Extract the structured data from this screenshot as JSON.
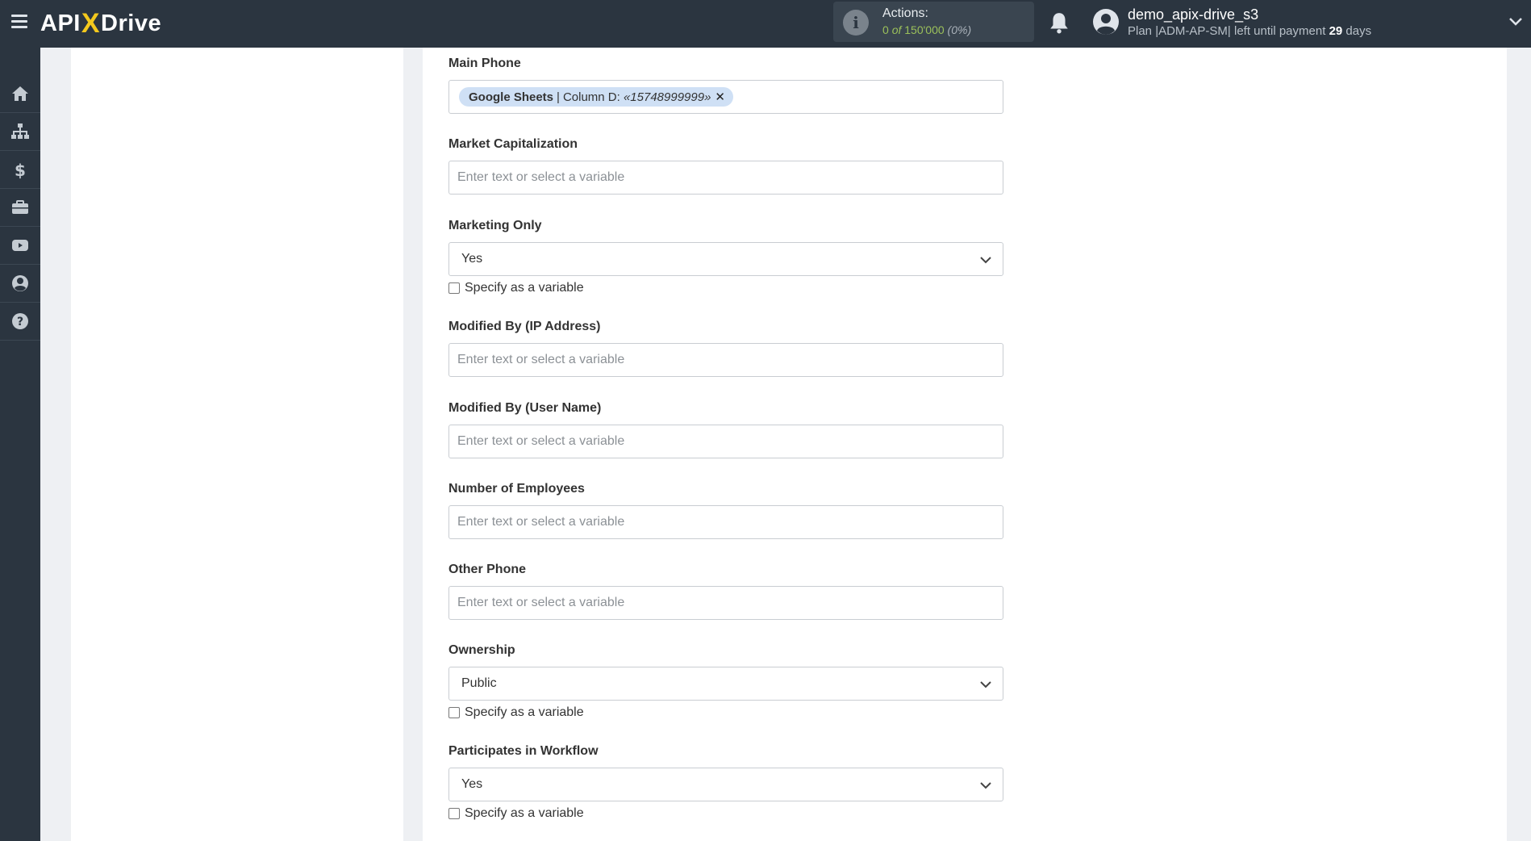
{
  "header": {
    "logo_api": "API",
    "logo_x": "X",
    "logo_drive": "Drive",
    "actions_label": "Actions:",
    "actions_used": "0",
    "actions_of": "of",
    "actions_total": "150'000",
    "actions_percent": "(0%)",
    "user_name": "demo_apix-drive_s3",
    "plan_text": "Plan |ADM-AP-SM| left until payment",
    "plan_days": "29",
    "plan_days_suffix": "days"
  },
  "sidebar": {
    "items": [
      {
        "name": "home-icon"
      },
      {
        "name": "sitemap-icon"
      },
      {
        "name": "dollar-icon"
      },
      {
        "name": "briefcase-icon"
      },
      {
        "name": "youtube-icon"
      },
      {
        "name": "user-circle-icon"
      },
      {
        "name": "help-icon"
      }
    ]
  },
  "fields": {
    "main_phone": {
      "label": "Main Phone",
      "tag_source": "Google Sheets",
      "tag_sep": "|",
      "tag_column": "Column D:",
      "tag_value": "«15748999999»",
      "tag_remove": "✕"
    },
    "market_cap": {
      "label": "Market Capitalization",
      "placeholder": "Enter text or select a variable"
    },
    "marketing_only": {
      "label": "Marketing Only",
      "value": "Yes",
      "checkbox": "Specify as a variable"
    },
    "modified_ip": {
      "label": "Modified By (IP Address)",
      "placeholder": "Enter text or select a variable"
    },
    "modified_user": {
      "label": "Modified By (User Name)",
      "placeholder": "Enter text or select a variable"
    },
    "num_employees": {
      "label": "Number of Employees",
      "placeholder": "Enter text or select a variable"
    },
    "other_phone": {
      "label": "Other Phone",
      "placeholder": "Enter text or select a variable"
    },
    "ownership": {
      "label": "Ownership",
      "value": "Public",
      "checkbox": "Specify as a variable"
    },
    "workflow": {
      "label": "Participates in Workflow",
      "value": "Yes",
      "checkbox": "Specify as a variable"
    }
  },
  "colors": {
    "topbar": "#2b3540",
    "accent_yellow": "#f4c91d",
    "actions_green": "#9bc05a",
    "tag_bg": "#cfe0f5"
  }
}
